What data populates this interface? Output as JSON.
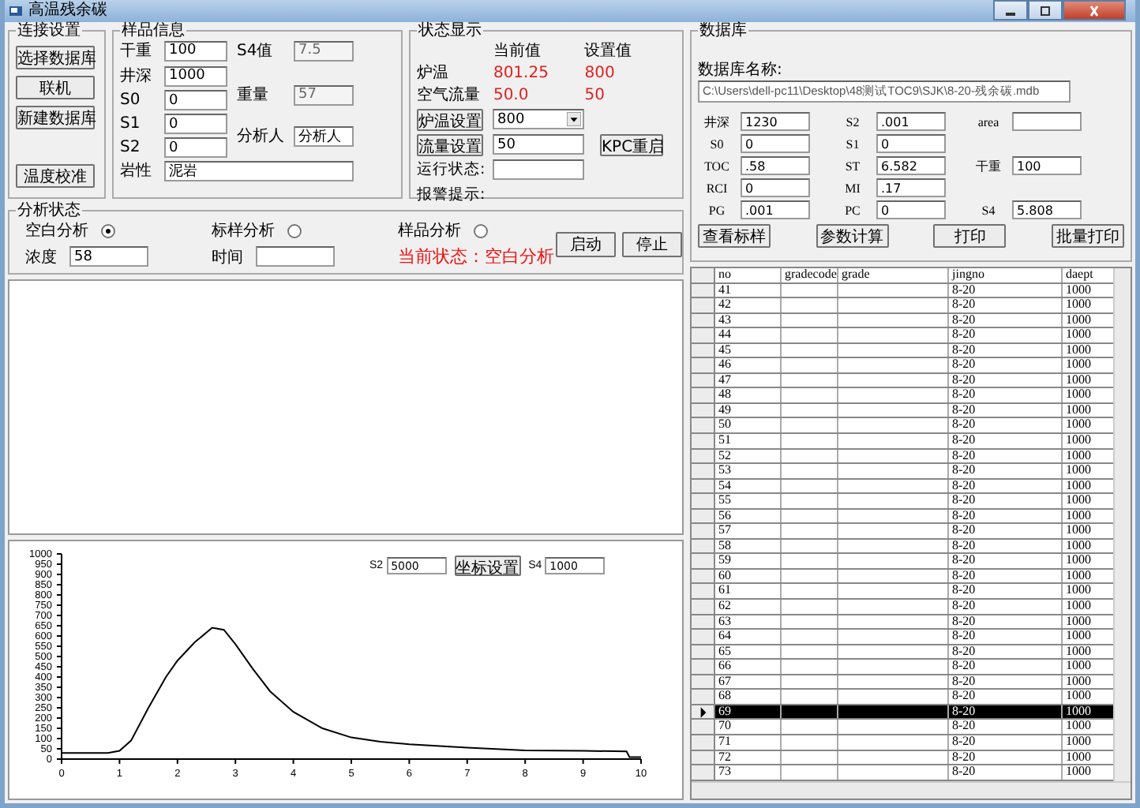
{
  "window": {
    "title": "高温残余碳"
  },
  "connection": {
    "title": "连接设置",
    "buttons": [
      "选择数据库",
      "联机",
      "新建数据库",
      "温度校准"
    ]
  },
  "sample": {
    "title": "样品信息",
    "left_fields": [
      {
        "label": "干重",
        "value": "100"
      },
      {
        "label": "井深",
        "value": "1000"
      },
      {
        "label": "S0",
        "value": "0"
      },
      {
        "label": "S1",
        "value": "0"
      },
      {
        "label": "S2",
        "value": "0"
      }
    ],
    "right_fields": [
      {
        "label": "S4值",
        "value": "7.5",
        "disabled": true
      },
      {
        "label": "重量",
        "value": "57",
        "disabled": true
      },
      {
        "label": "分析人",
        "value": "分析人",
        "disabled": false
      }
    ],
    "lithology": {
      "label": "岩性",
      "value": "泥岩"
    }
  },
  "status": {
    "title": "状态显示",
    "headers": [
      "当前值",
      "设置值"
    ],
    "readings": [
      {
        "label": "炉温",
        "current": "801.25",
        "setpoint": "800"
      },
      {
        "label": "空气流量",
        "current": "50.0",
        "setpoint": "50"
      }
    ],
    "controls": [
      {
        "kind": "select",
        "button": "炉温设置",
        "value": "800"
      },
      {
        "kind": "input",
        "button": "流量设置",
        "value": "50"
      }
    ],
    "restart_button": "KPC重启",
    "run_state_label": "运行状态:",
    "alarm_label": "报警提示:"
  },
  "analysis": {
    "title": "分析状态",
    "modes": [
      {
        "label": "空白分析",
        "selected": true
      },
      {
        "label": "标样分析",
        "selected": false
      },
      {
        "label": "样品分析",
        "selected": false
      }
    ],
    "concentration": {
      "label": "浓度",
      "value": "58"
    },
    "time": {
      "label": "时间"
    },
    "current_state": "当前状态：空白分析",
    "buttons": [
      "启动",
      "停止"
    ]
  },
  "database": {
    "title": "数据库",
    "name_label": "数据库名称:",
    "path": "C:\\Users\\dell-pc11\\Desktop\\48测试TOC9\\SJK\\8-20-残余碳.mdb",
    "rows": [
      [
        {
          "label": "井深",
          "value": "1230"
        },
        {
          "label": "S2",
          "value": ".001"
        },
        {
          "label": "area"
        }
      ],
      [
        {
          "label": "S0",
          "value": "0"
        },
        {
          "label": "S1",
          "value": "0"
        },
        null
      ],
      [
        {
          "label": "TOC",
          "value": ".58"
        },
        {
          "label": "ST",
          "value": "6.582"
        },
        {
          "label": "干重",
          "value": "100"
        }
      ],
      [
        {
          "label": "RCI",
          "value": "0"
        },
        {
          "label": "MI",
          "value": ".17"
        },
        null
      ],
      [
        {
          "label": "PG",
          "value": ".001"
        },
        {
          "label": "PC",
          "value": "0"
        },
        {
          "label": "S4",
          "value": "5.808"
        }
      ]
    ],
    "buttons": [
      "查看标样",
      "参数计算",
      "打印",
      "批量打印"
    ]
  },
  "chart": {
    "s2": {
      "label": "S2",
      "value": "5000"
    },
    "axis_button": "坐标设置",
    "s4": {
      "label": "S4",
      "value": "1000"
    },
    "chart_data": {
      "type": "line",
      "xlim": [
        0,
        10
      ],
      "ylim": [
        0,
        1000
      ],
      "xticks": [
        0,
        1,
        2,
        3,
        4,
        5,
        6,
        7,
        8,
        9,
        10
      ],
      "yticks": [
        0,
        50,
        100,
        150,
        200,
        250,
        300,
        350,
        400,
        450,
        500,
        550,
        600,
        650,
        700,
        750,
        800,
        850,
        900,
        950,
        1000
      ],
      "x": [
        0,
        0.8,
        1,
        1.2,
        1.5,
        1.8,
        2,
        2.3,
        2.6,
        2.8,
        3,
        3.3,
        3.6,
        4,
        4.5,
        5,
        5.5,
        6,
        7,
        8,
        9,
        9.75,
        9.8,
        10
      ],
      "series": [
        {
          "color": "#000000",
          "values": [
            30,
            30,
            40,
            90,
            250,
            400,
            480,
            570,
            640,
            630,
            560,
            440,
            330,
            230,
            150,
            105,
            85,
            72,
            55,
            42,
            40,
            38,
            10,
            10
          ]
        }
      ]
    }
  },
  "table": {
    "columns": [
      "no",
      "gradecode",
      "grade",
      "jingno",
      "daept"
    ],
    "rows": [
      {
        "no": "41",
        "jingno": "8-20",
        "daept": "1000",
        "selected": false
      },
      {
        "no": "42",
        "jingno": "8-20",
        "daept": "1000",
        "selected": false
      },
      {
        "no": "43",
        "jingno": "8-20",
        "daept": "1000",
        "selected": false
      },
      {
        "no": "44",
        "jingno": "8-20",
        "daept": "1000",
        "selected": false
      },
      {
        "no": "45",
        "jingno": "8-20",
        "daept": "1000",
        "selected": false
      },
      {
        "no": "46",
        "jingno": "8-20",
        "daept": "1000",
        "selected": false
      },
      {
        "no": "47",
        "jingno": "8-20",
        "daept": "1000",
        "selected": false
      },
      {
        "no": "48",
        "jingno": "8-20",
        "daept": "1000",
        "selected": false
      },
      {
        "no": "49",
        "jingno": "8-20",
        "daept": "1000",
        "selected": false
      },
      {
        "no": "50",
        "jingno": "8-20",
        "daept": "1000",
        "selected": false
      },
      {
        "no": "51",
        "jingno": "8-20",
        "daept": "1000",
        "selected": false
      },
      {
        "no": "52",
        "jingno": "8-20",
        "daept": "1000",
        "selected": false
      },
      {
        "no": "53",
        "jingno": "8-20",
        "daept": "1000",
        "selected": false
      },
      {
        "no": "54",
        "jingno": "8-20",
        "daept": "1000",
        "selected": false
      },
      {
        "no": "55",
        "jingno": "8-20",
        "daept": "1000",
        "selected": false
      },
      {
        "no": "56",
        "jingno": "8-20",
        "daept": "1000",
        "selected": false
      },
      {
        "no": "57",
        "jingno": "8-20",
        "daept": "1000",
        "selected": false
      },
      {
        "no": "58",
        "jingno": "8-20",
        "daept": "1000",
        "selected": false
      },
      {
        "no": "59",
        "jingno": "8-20",
        "daept": "1000",
        "selected": false
      },
      {
        "no": "60",
        "jingno": "8-20",
        "daept": "1000",
        "selected": false
      },
      {
        "no": "61",
        "jingno": "8-20",
        "daept": "1000",
        "selected": false
      },
      {
        "no": "62",
        "jingno": "8-20",
        "daept": "1000",
        "selected": false
      },
      {
        "no": "63",
        "jingno": "8-20",
        "daept": "1000",
        "selected": false
      },
      {
        "no": "64",
        "jingno": "8-20",
        "daept": "1000",
        "selected": false
      },
      {
        "no": "65",
        "jingno": "8-20",
        "daept": "1000",
        "selected": false
      },
      {
        "no": "66",
        "jingno": "8-20",
        "daept": "1000",
        "selected": false
      },
      {
        "no": "67",
        "jingno": "8-20",
        "daept": "1000",
        "selected": false
      },
      {
        "no": "68",
        "jingno": "8-20",
        "daept": "1000",
        "selected": false
      },
      {
        "no": "69",
        "jingno": "8-20",
        "daept": "1000",
        "selected": true
      },
      {
        "no": "70",
        "jingno": "8-20",
        "daept": "1000",
        "selected": false
      },
      {
        "no": "71",
        "jingno": "8-20",
        "daept": "1000",
        "selected": false
      },
      {
        "no": "72",
        "jingno": "8-20",
        "daept": "1000",
        "selected": false
      },
      {
        "no": "73",
        "jingno": "8-20",
        "daept": "1000",
        "selected": false
      }
    ]
  }
}
